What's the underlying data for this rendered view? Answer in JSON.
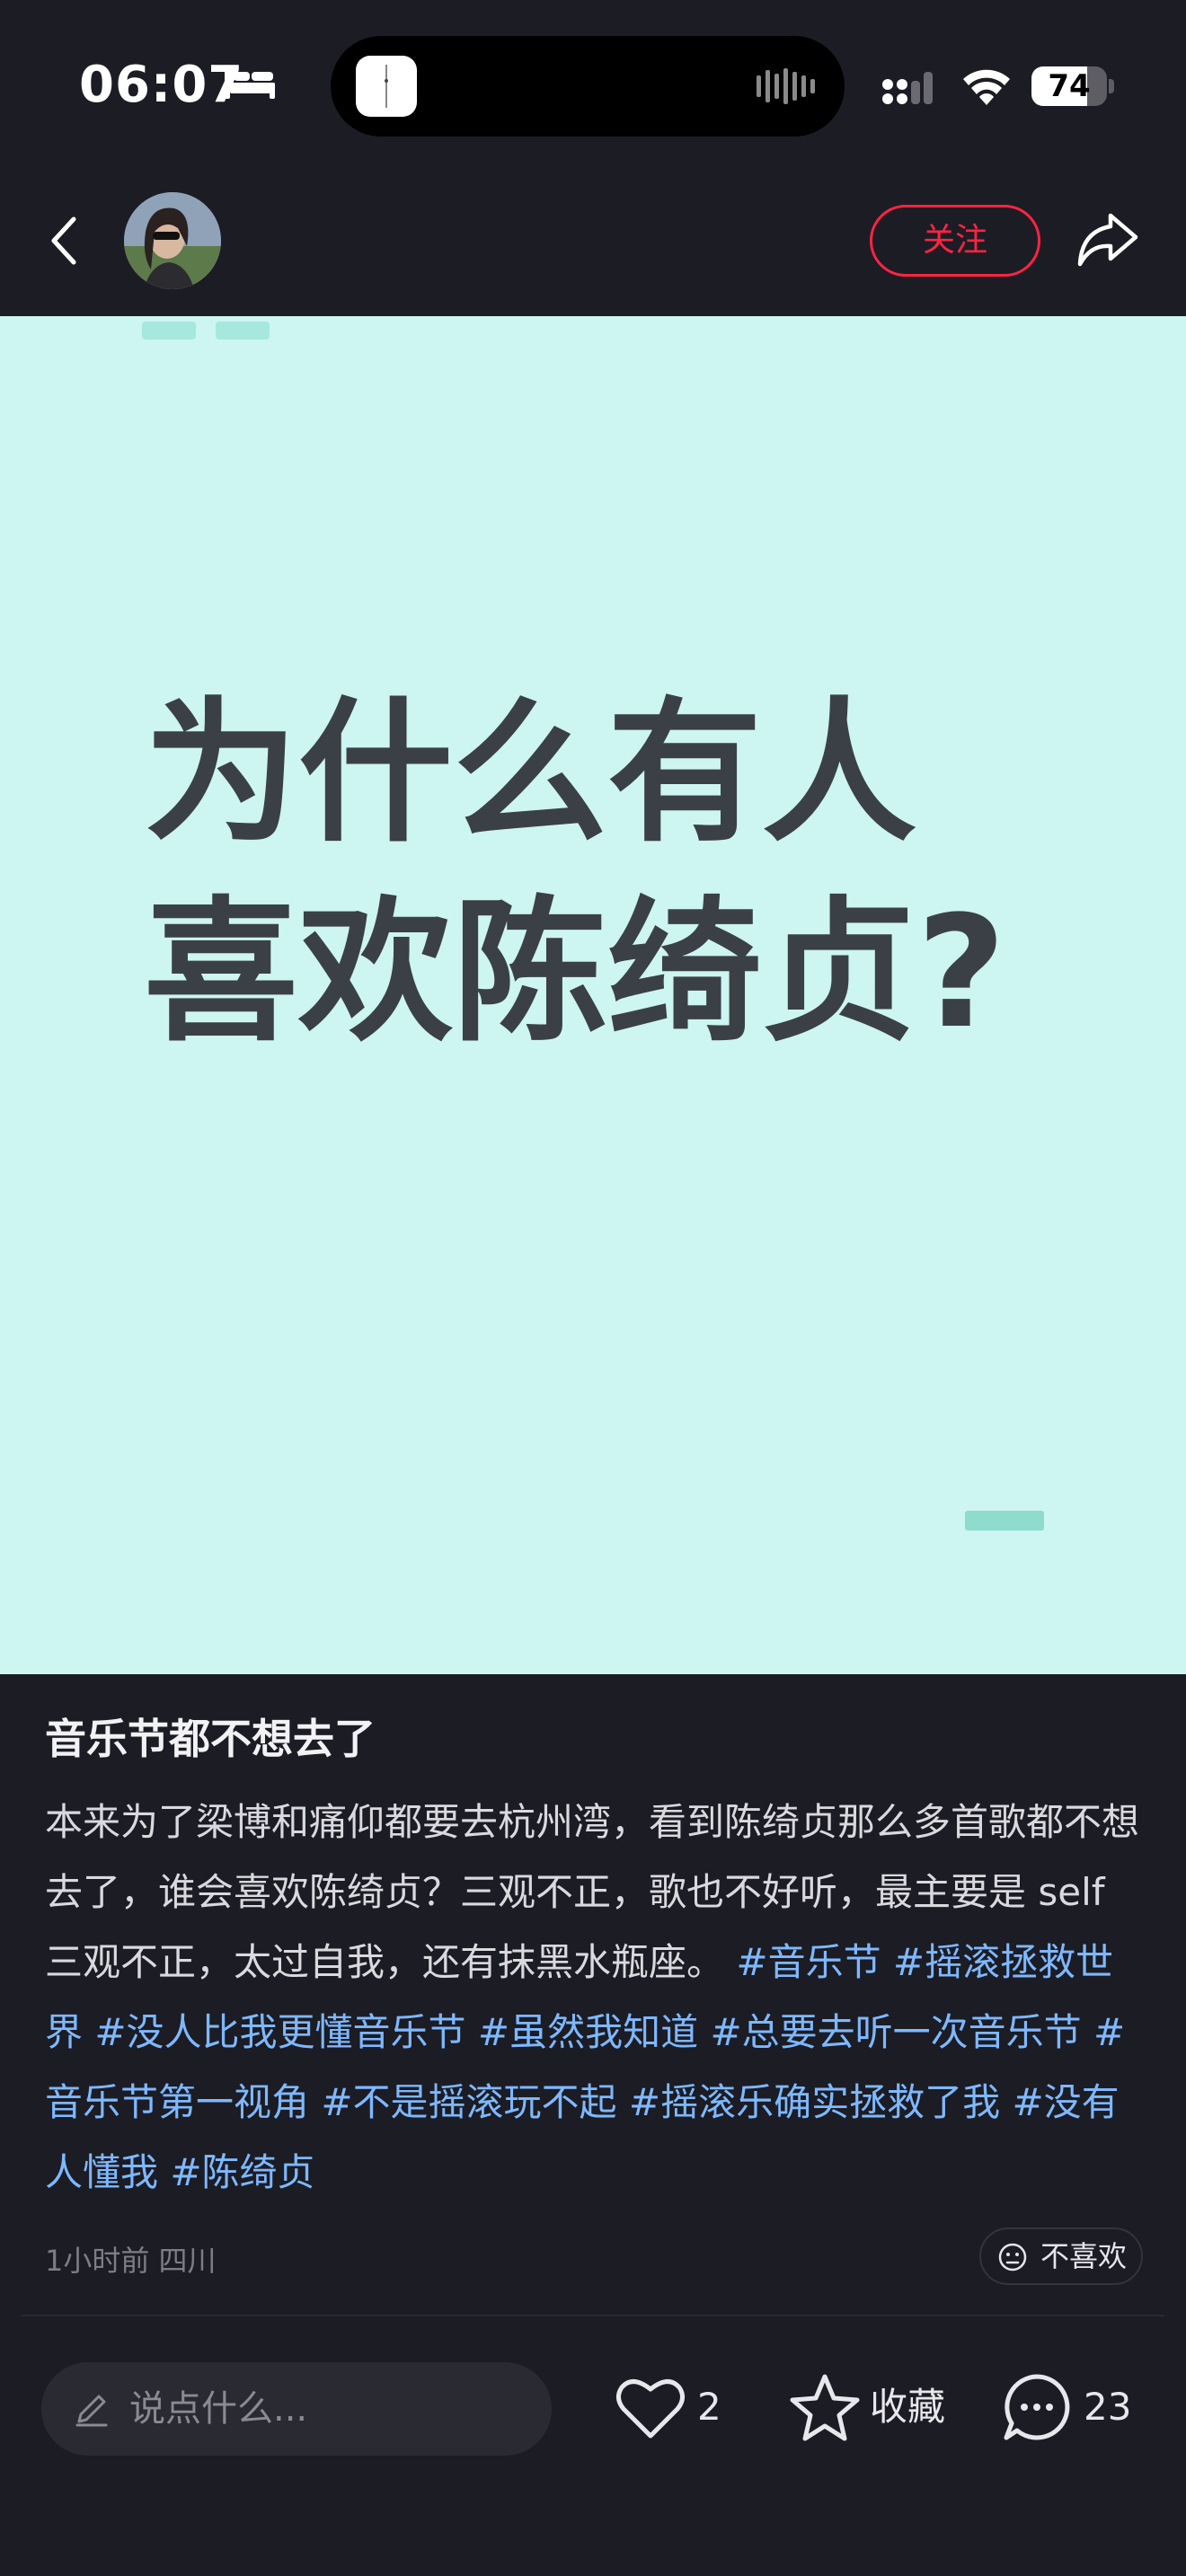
{
  "status_bar": {
    "time": "06:07",
    "battery": "74"
  },
  "nav": {
    "follow_label": "关注"
  },
  "post_image": {
    "title": "为什么有人\n喜欢陈绮贞?",
    "background": "#cdf5f1",
    "text_color": "#3b4047"
  },
  "post": {
    "title": "音乐节都不想去了",
    "body": "本来为了梁博和痛仰都要去杭州湾，看到陈绮贞那么多首歌都不想去了，谁会喜欢陈绮贞？三观不正，歌也不好听，最主要是 self 三观不正，太过自我，还有抹黑水瓶座。",
    "tags": [
      "#音乐节",
      "#摇滚拯救世界",
      "#没人比我更懂音乐节",
      "#虽然我知道",
      "#总要去听一次音乐节",
      "#音乐节第一视角",
      "#不是摇滚玩不起",
      "#摇滚乐确实拯救了我",
      "#没有人懂我",
      "#陈绮贞"
    ],
    "meta": "1小时前 四川",
    "dislike_label": "不喜欢"
  },
  "bottom_bar": {
    "comment_placeholder": "说点什么...",
    "like_count": "2",
    "collect_label": "收藏",
    "comment_count": "23"
  },
  "colors": {
    "accent": "#ff2442",
    "tag": "#7eb8ff",
    "background": "#1c1c24"
  },
  "icons": [
    "bed-icon",
    "wifi-icon",
    "signal-icon",
    "battery-icon",
    "back-icon",
    "share-icon",
    "dislike-face-icon",
    "pencil-icon",
    "heart-icon",
    "star-icon",
    "comment-bubble-icon"
  ]
}
